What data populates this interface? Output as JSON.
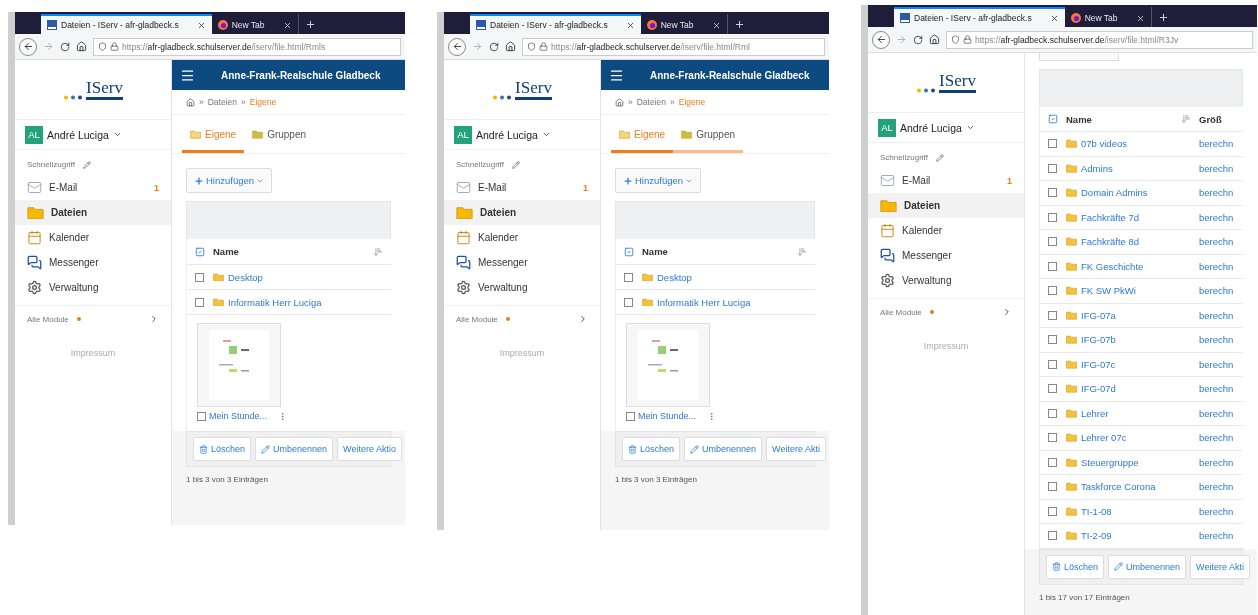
{
  "panels": [
    {
      "browser": {
        "tabs": [
          {
            "title": "Dateien - IServ - afr-gladbeck.s",
            "kind": "site",
            "selected": true
          },
          {
            "title": "New Tab",
            "kind": "firefox",
            "selected": false
          }
        ],
        "url": {
          "scheme": "https://",
          "host": "afr-gladbeck.schulserver.de",
          "path": "/iserv/file.html/Rmls"
        }
      },
      "sidebar": {
        "logo": "IServ",
        "user": {
          "initials": "AL",
          "name": "André Luciga"
        },
        "quick_access": "Schnellzugriff",
        "items": [
          {
            "label": "E-Mail",
            "kind": "mail",
            "badge": "1",
            "selected": false
          },
          {
            "label": "Dateien",
            "kind": "folder",
            "selected": true
          },
          {
            "label": "Kalender",
            "kind": "calendar",
            "selected": false
          },
          {
            "label": "Messenger",
            "kind": "chat",
            "selected": false
          },
          {
            "label": "Verwaltung",
            "kind": "gear",
            "selected": false
          }
        ],
        "all_modules": "Alle Module",
        "impressum": "Impressum"
      },
      "main": {
        "scrolled": false,
        "header": "Anne-Frank-Realschule Gladbeck",
        "breadcrumb_separator": "»",
        "breadcrumb": [
          "Dateien",
          "Eigene"
        ],
        "tabs": [
          {
            "label": "Eigene",
            "selected": true,
            "hovered": false
          },
          {
            "label": "Gruppen",
            "selected": false,
            "hovered": false
          }
        ],
        "add_button": "Hinzufügen",
        "table": {
          "columns": [
            "Name"
          ],
          "rows": [
            {
              "name": "Desktop",
              "checked": false
            },
            {
              "name": "Informatik Herr Luciga",
              "checked": false
            }
          ]
        },
        "tile": {
          "label": "Mein Stunde...",
          "checked": false
        },
        "actions": [
          "Löschen",
          "Umbenennen",
          "Weitere Aktio"
        ],
        "footer": "1 bis 3 von 3 Einträgen"
      }
    },
    {
      "browser": {
        "tabs": [
          {
            "title": "Dateien - IServ - afr-gladbeck.s",
            "kind": "site",
            "selected": true
          },
          {
            "title": "New Tab",
            "kind": "firefox",
            "selected": false
          }
        ],
        "url": {
          "scheme": "https://",
          "host": "afr-gladbeck.schulserver.de",
          "path": "/iserv/file.html/Rml"
        }
      },
      "sidebar": {
        "logo": "IServ",
        "user": {
          "initials": "AL",
          "name": "André Luciga"
        },
        "quick_access": "Schnellzugriff",
        "items": [
          {
            "label": "E-Mail",
            "kind": "mail",
            "badge": "1",
            "selected": false
          },
          {
            "label": "Dateien",
            "kind": "folder",
            "selected": true
          },
          {
            "label": "Kalender",
            "kind": "calendar",
            "selected": false
          },
          {
            "label": "Messenger",
            "kind": "chat",
            "selected": false
          },
          {
            "label": "Verwaltung",
            "kind": "gear",
            "selected": false
          }
        ],
        "all_modules": "Alle Module",
        "impressum": "Impressum"
      },
      "main": {
        "scrolled": false,
        "header": "Anne-Frank-Realschule Gladbeck",
        "breadcrumb_separator": "»",
        "breadcrumb": [
          "Dateien",
          "Eigene"
        ],
        "tabs": [
          {
            "label": "Eigene",
            "selected": true,
            "hovered": false
          },
          {
            "label": "Gruppen",
            "selected": false,
            "hovered": true
          }
        ],
        "add_button": "Hinzufügen",
        "table": {
          "columns": [
            "Name"
          ],
          "rows": [
            {
              "name": "Desktop",
              "checked": false
            },
            {
              "name": "Informatik Herr Luciga",
              "checked": false
            }
          ]
        },
        "tile": {
          "label": "Mein Stunde...",
          "checked": false
        },
        "actions": [
          "Löschen",
          "Umbenennen",
          "Weitere Akti"
        ],
        "footer": "1 bis 3 von 3 Einträgen"
      }
    },
    {
      "browser": {
        "tabs": [
          {
            "title": "Dateien - IServ - afr-gladbeck.s",
            "kind": "site",
            "selected": true
          },
          {
            "title": "New Tab",
            "kind": "firefox",
            "selected": false
          }
        ],
        "url": {
          "scheme": "https://",
          "host": "afr-gladbeck.schulserver.de",
          "path": "/iserv/file.html/R3Jv"
        }
      },
      "sidebar": {
        "logo": "IServ",
        "user": {
          "initials": "AL",
          "name": "André Luciga"
        },
        "quick_access": "Schnellzugriff",
        "items": [
          {
            "label": "E-Mail",
            "kind": "mail",
            "badge": "1",
            "selected": false
          },
          {
            "label": "Dateien",
            "kind": "folder",
            "selected": true
          },
          {
            "label": "Kalender",
            "kind": "calendar",
            "selected": false
          },
          {
            "label": "Messenger",
            "kind": "chat",
            "selected": false
          },
          {
            "label": "Verwaltung",
            "kind": "gear",
            "selected": false
          }
        ],
        "all_modules": "Alle Module",
        "impressum": "Impressum"
      },
      "main": {
        "scrolled": true,
        "table": {
          "columns": [
            "Name",
            "Größ"
          ],
          "rows": [
            {
              "name": "07b videos",
              "size": "berechn",
              "checked": false
            },
            {
              "name": "Admins",
              "size": "berechn",
              "checked": false
            },
            {
              "name": "Domain Admins",
              "size": "berechn",
              "checked": false
            },
            {
              "name": "Fachkräfte 7d",
              "size": "berechn",
              "checked": false
            },
            {
              "name": "Fachkräfte 8d",
              "size": "berechn",
              "checked": false
            },
            {
              "name": "FK Geschichte",
              "size": "berechn",
              "checked": false
            },
            {
              "name": "FK SW PkWi",
              "size": "berechn",
              "checked": false
            },
            {
              "name": "IFG-07a",
              "size": "berechn",
              "checked": false
            },
            {
              "name": "IFG-07b",
              "size": "berechn",
              "checked": false
            },
            {
              "name": "IFG-07c",
              "size": "berechn",
              "checked": false
            },
            {
              "name": "IFG-07d",
              "size": "berechn",
              "checked": false
            },
            {
              "name": "Lehrer",
              "size": "berechn",
              "checked": false
            },
            {
              "name": "Lehrer 07c",
              "size": "berechn",
              "checked": false
            },
            {
              "name": "Steuergruppe",
              "size": "berechn",
              "checked": false
            },
            {
              "name": "Taskforce Corona",
              "size": "berechn",
              "checked": false
            },
            {
              "name": "TI-1-08",
              "size": "berechn",
              "checked": false
            },
            {
              "name": "TI-2-09",
              "size": "berechn",
              "checked": false
            }
          ]
        },
        "actions": [
          "Löschen",
          "Umbenennen",
          "Weitere Akti"
        ],
        "footer": "1 bis 17 von 17 Einträgen"
      }
    }
  ]
}
